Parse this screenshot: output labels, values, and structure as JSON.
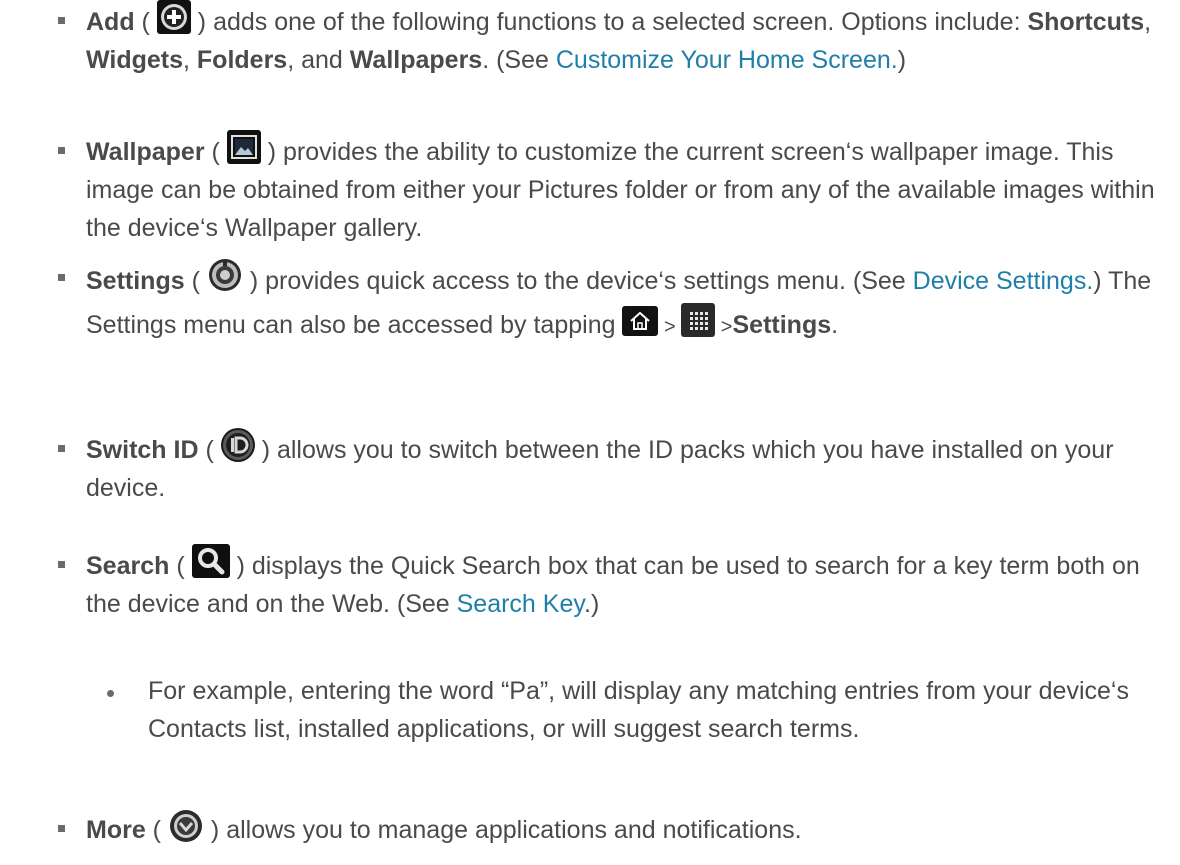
{
  "items": [
    {
      "bold": "Add",
      "open": " (",
      "icon": "add-circle-icon",
      "close": ") adds one of the following functions to a selected screen. Options include: ",
      "opt1": "Shortcuts",
      "sep1": ", ",
      "opt2": "Widgets",
      "sep2": ", ",
      "opt3": "Folders",
      "sep3": ", and ",
      "opt4": "Wallpapers",
      "tail1": ". (See ",
      "link": "Customize Your Home Screen.",
      "tail2": ")"
    },
    {
      "bold": "Wallpaper",
      "open": " (",
      "icon": "picture-icon",
      "close": ") provides the ability to customize the current screen‘s wallpaper image. This image can be obtained from either your Pictures folder or from any of the available images within the device‘s Wallpaper gallery."
    },
    {
      "bold": "Settings",
      "open": " (",
      "icon": "settings-gear-icon",
      "close": ") provides quick access to the device‘s settings menu. (See ",
      "link": "Device Settings.",
      "tail": ") The Settings menu can also be accessed by tapping ",
      "icon2": "home-icon",
      "gt1": " > ",
      "icon3": "apps-grid-icon",
      "gt2": " >",
      "bold2": "Settings",
      "end": "."
    },
    {
      "bold": "Switch ID",
      "open": " (",
      "icon": "switch-id-icon",
      "close": ") allows you to switch between the ID packs which you have installed on your device."
    },
    {
      "bold": "Search",
      "open": " (",
      "icon": "search-icon",
      "close": ") displays the Quick Search box that can be used to search for a key term both on the device and on the Web. (See ",
      "link": "Search Key",
      "tail": ".)"
    },
    {
      "bold": "More",
      "open": " (",
      "icon": "more-chevron-icon",
      "close": ") allows you to manage applications and notifications."
    }
  ],
  "subitem": "For example, entering the word “Pa”, will display any matching entries from your device‘s Contacts list, installed applications, or will suggest search terms."
}
